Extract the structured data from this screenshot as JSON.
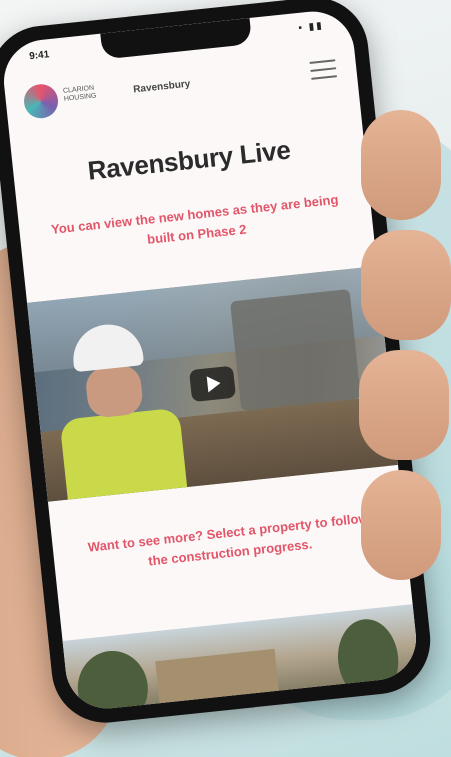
{
  "status_bar": {
    "time": "9:41",
    "icons": "▪ ▮▮"
  },
  "header": {
    "logo_text": "CLARION HOUSING",
    "title": "Ravensbury"
  },
  "page": {
    "title": "Ravensbury Live",
    "intro": "You can view the new homes as they are being built on Phase 2",
    "cta": "Want to see more? Select a property to follow the construction progress."
  },
  "icons": {
    "menu": "hamburger-menu-icon",
    "play": "play-icon"
  },
  "colors": {
    "accent": "#e2566a",
    "title": "#2b2b2b"
  }
}
